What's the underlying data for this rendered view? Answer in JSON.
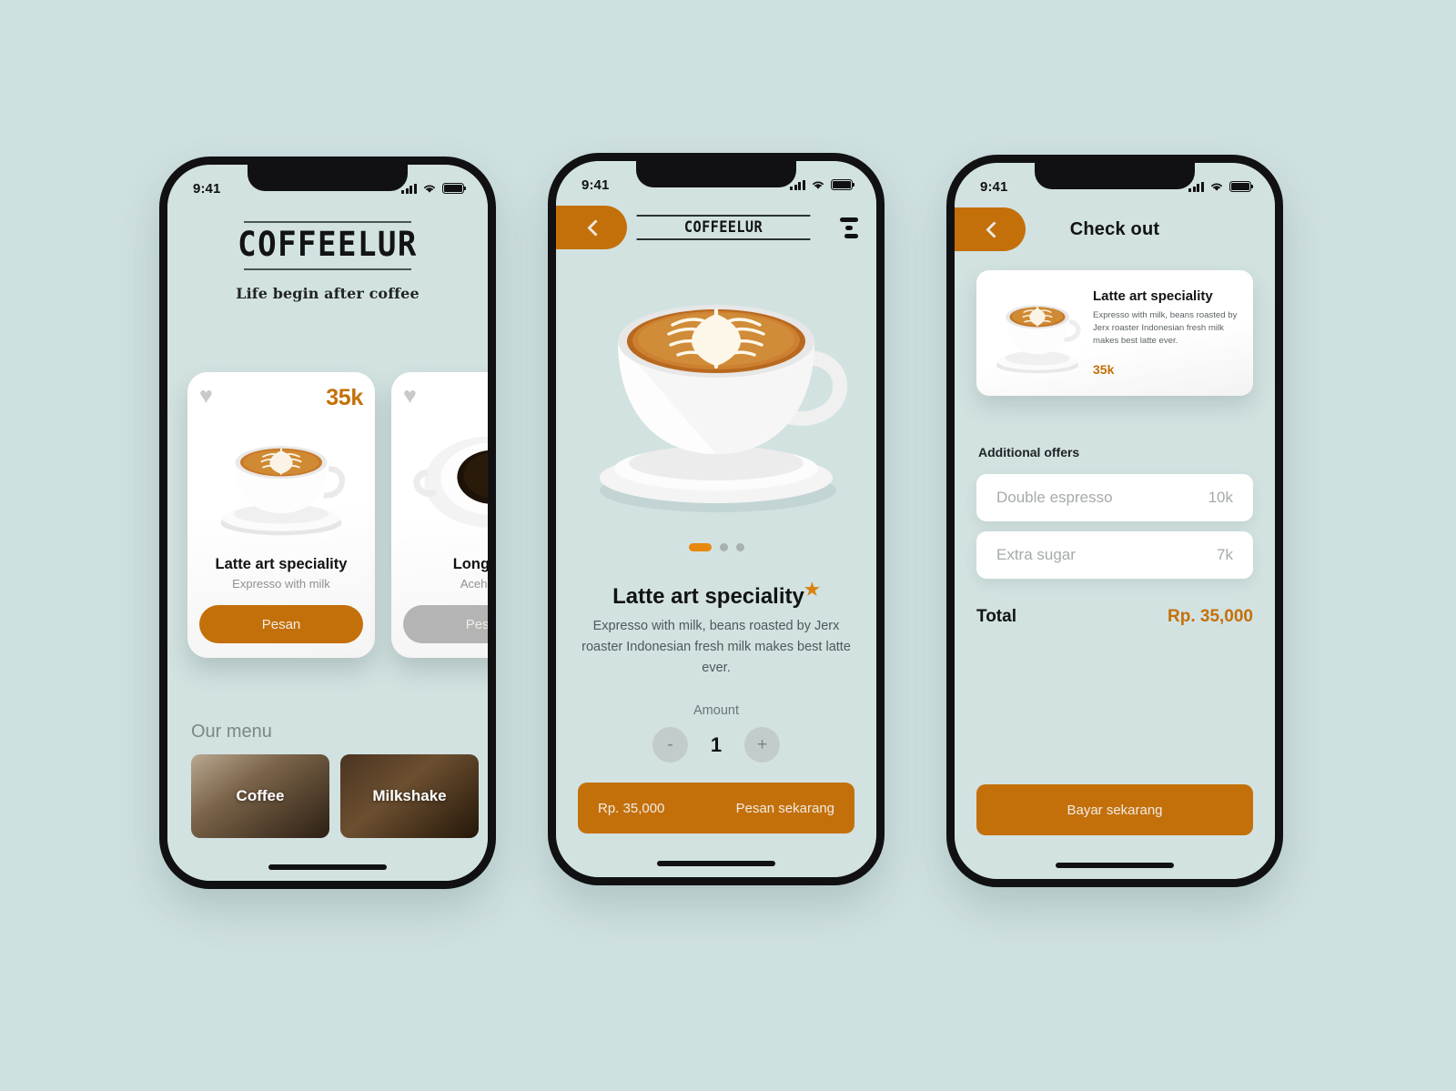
{
  "theme": {
    "background": "#cfe0e0",
    "accent": "#c4700a",
    "accent_bright": "#e8880c",
    "card": "#ffffff",
    "muted": "#b4b4b4"
  },
  "status_bar": {
    "time": "9:41"
  },
  "screen_home": {
    "brand_title": "COFFEELUR",
    "brand_tagline": "Life begin after coffee",
    "products": [
      {
        "name": "Latte art speciality",
        "subtitle": "Expresso with milk",
        "price": "35k",
        "order_label": "Pesan",
        "favorite_icon": "heart-icon"
      },
      {
        "name": "Long Bla",
        "subtitle": "Aceh gay",
        "price": "",
        "order_label": "Pesan",
        "favorite_icon": "heart-icon"
      }
    ],
    "menu_heading": "Our menu",
    "menu_tiles": [
      {
        "label": "Coffee"
      },
      {
        "label": "Milkshake"
      },
      {
        "label": ""
      }
    ]
  },
  "screen_detail": {
    "logo": "COFFEELUR",
    "back_icon": "chevron-left-icon",
    "menu_icon": "hamburger-menu-icon",
    "carousel": {
      "slides": 3,
      "active": 1
    },
    "title": "Latte art speciality",
    "title_star": "★",
    "description": "Expresso with milk, beans roasted by Jerx roaster Indonesian fresh milk makes best latte ever.",
    "amount_label": "Amount",
    "amount_value": "1",
    "decrement_label": "-",
    "increment_label": "+",
    "price": "Rp. 35,000",
    "cta_label": "Pesan sekarang"
  },
  "screen_checkout": {
    "title": "Check out",
    "back_icon": "chevron-left-icon",
    "item": {
      "name": "Latte art speciality",
      "description": "Expresso with milk, beans roasted by Jerx roaster Indonesian fresh milk makes best latte ever.",
      "price": "35k"
    },
    "offers_label": "Additional offers",
    "offers": [
      {
        "name": "Double espresso",
        "price": "10k"
      },
      {
        "name": "Extra sugar",
        "price": "7k"
      }
    ],
    "total_label": "Total",
    "total_value": "Rp. 35,000",
    "cta_label": "Bayar sekarang"
  }
}
